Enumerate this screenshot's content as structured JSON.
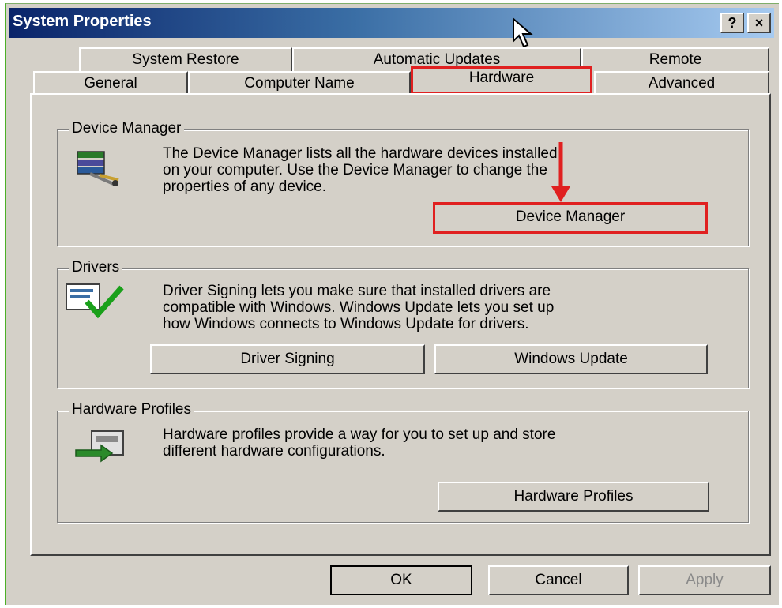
{
  "window": {
    "title": "System Properties",
    "help_button": "?",
    "close_button": "×"
  },
  "tabs": {
    "row_top": [
      "System Restore",
      "Automatic Updates",
      "Remote"
    ],
    "row_bottom": [
      "General",
      "Computer Name",
      "Hardware",
      "Advanced"
    ],
    "active": "Hardware"
  },
  "device_manager": {
    "title": "Device Manager",
    "description_lines": [
      "The Device Manager lists all the hardware devices installed",
      "on your computer. Use the Device Manager to change the",
      "properties of any device."
    ],
    "button_label": "Device Manager"
  },
  "drivers": {
    "title": "Drivers",
    "description_lines": [
      "Driver Signing lets you make sure that installed drivers are",
      "compatible with Windows. Windows Update lets you set up",
      "how Windows connects to Windows Update for drivers."
    ],
    "driver_signing_label": "Driver Signing",
    "windows_update_label": "Windows Update"
  },
  "hardware_profiles": {
    "title": "Hardware Profiles",
    "description_lines": [
      "Hardware profiles provide a way for you to set up and store",
      "different hardware configurations."
    ],
    "button_label": "Hardware Profiles"
  },
  "footer": {
    "ok_label": "OK",
    "cancel_label": "Cancel",
    "apply_label": "Apply"
  },
  "colors": {
    "annotation_red": "#e02020",
    "dialog_face": "#d4d0c8",
    "title_blue": "#0a246a"
  },
  "icons": [
    "device-manager-icon",
    "driver-signing-icon",
    "hardware-profiles-icon",
    "mouse-cursor-icon",
    "annotation-arrow-icon"
  ]
}
